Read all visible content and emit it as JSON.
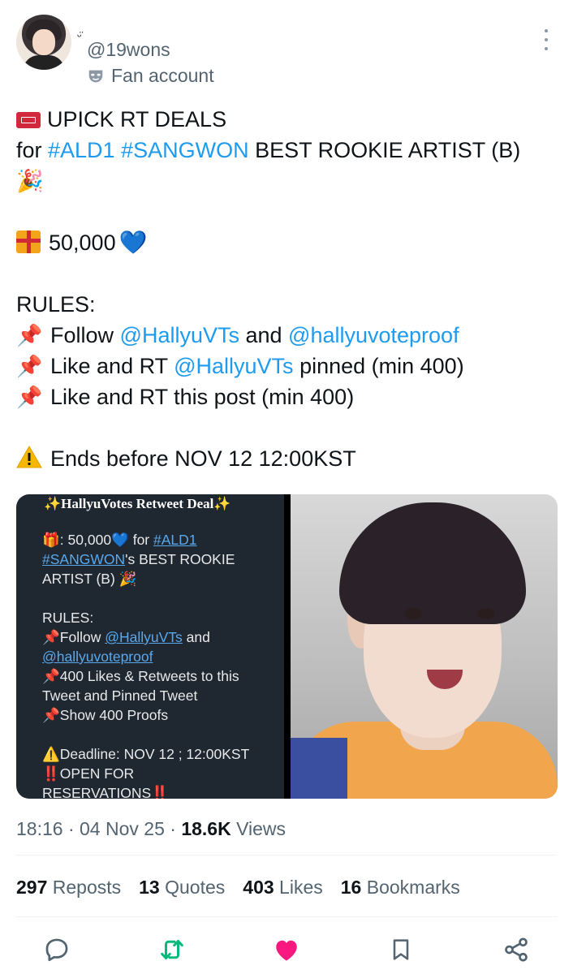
{
  "header": {
    "badge_emoji": "ᵕ̈",
    "handle": "@19wons",
    "account_label": "Fan account"
  },
  "tweet": {
    "line1": "UPICK RT DEALS",
    "line2_pre": "for ",
    "line2_tag1": "#ALD1",
    "line2_tag2": "#SANGWON",
    "line2_post": " BEST ROOKIE ARTIST (B)",
    "line3_emoji": "🎉",
    "prize": "50,000",
    "rules_title": "RULES:",
    "rule1_pre": "Follow ",
    "rule1_link1": "@HallyuVTs",
    "rule1_mid": " and ",
    "rule1_link2": "@hallyuvoteproof",
    "rule2_pre": "Like and RT ",
    "rule2_link": "@HallyuVTs",
    "rule2_post": " pinned (min 400)",
    "rule3": "Like and RT this post (min 400)",
    "ends": "Ends before NOV 12 12:00KST"
  },
  "media_left": {
    "title": "✨HallyuVotes Retweet Deal✨",
    "prize_pre": ": 50,000",
    "prize_for": " for ",
    "tag1": "#ALD1",
    "tag2": "#SANGWON",
    "tag2_post": "'s BEST ROOKIE",
    "line3": "ARTIST (B) 🎉",
    "rules": "RULES:",
    "r1_pre": "Follow ",
    "r1_link": "@HallyuVTs",
    "r1_post": " and",
    "r1_link2": "@hallyuvoteproof",
    "r2": "400 Likes & Retweets to this",
    "r2b": "Tweet and Pinned Tweet",
    "r3": "Show 400 Proofs",
    "deadline": "Deadline: NOV 12 ; 12:00KST",
    "open1": "OPEN FOR",
    "open2": "RESERVATIONS"
  },
  "meta": {
    "time": "18:16",
    "date": "04 Nov 25",
    "views_count": "18.6K",
    "views_label": "Views",
    "sep": "·"
  },
  "stats": {
    "reposts_count": "297",
    "reposts_label": "Reposts",
    "quotes_count": "13",
    "quotes_label": "Quotes",
    "likes_count": "403",
    "likes_label": "Likes",
    "bookmarks_count": "16",
    "bookmarks_label": "Bookmarks"
  },
  "icons": {
    "reply": "reply-icon",
    "repost": "repost-icon",
    "like": "like-icon",
    "bookmark": "bookmark-icon",
    "share": "share-icon",
    "accent_repost": "#00ba7c",
    "accent_like": "#f91880",
    "link_color": "#1d9bf0"
  }
}
